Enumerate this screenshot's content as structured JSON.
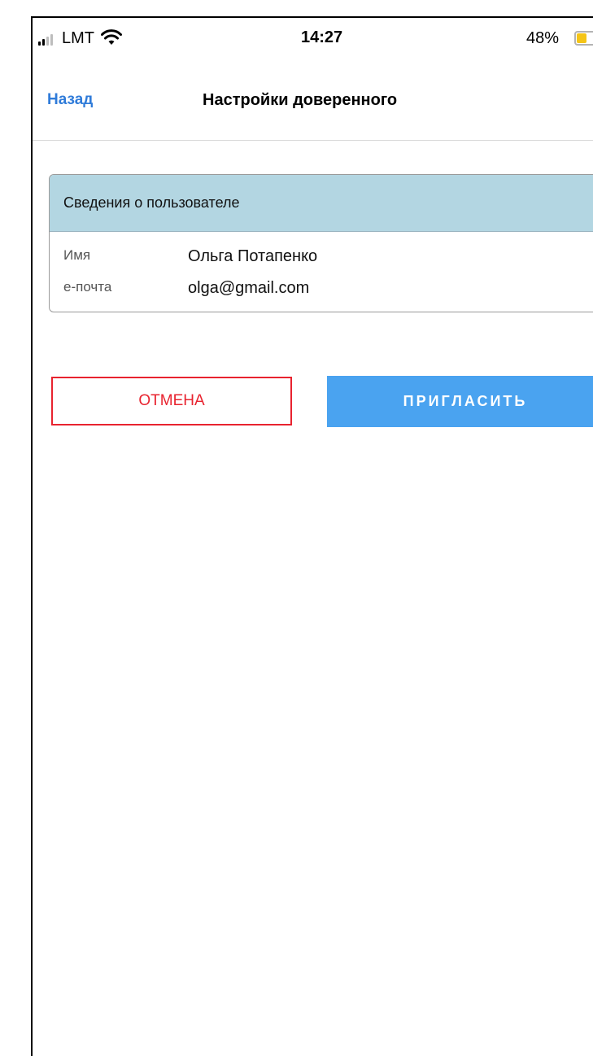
{
  "status_bar": {
    "carrier": "LMT",
    "time": "14:27",
    "battery_percent": "48%",
    "battery_level": 0.48,
    "signal_icon": "cellular-signal-icon",
    "wifi_icon": "wifi-icon",
    "battery_icon": "battery-icon",
    "battery_color": "#f5c518"
  },
  "nav": {
    "back_label": "Назад",
    "title": "Настройки доверенного",
    "accent_color": "#2f7bd9"
  },
  "user_card": {
    "header": "Сведения о пользователе",
    "header_bg": "#b3d6e2",
    "rows": [
      {
        "label": "Имя",
        "value": "Ольга Потапенко"
      },
      {
        "label": "e-почта",
        "value": "olga@gmail.com"
      }
    ]
  },
  "actions": {
    "cancel_label": "ОТМЕНА",
    "cancel_color": "#e8232f",
    "invite_label": "ПРИГЛАСИТЬ",
    "invite_color": "#4aa3f0"
  }
}
